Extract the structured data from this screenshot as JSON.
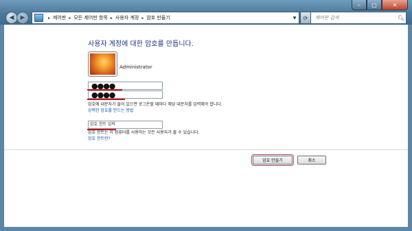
{
  "window": {
    "controls": {
      "minimize": "–",
      "maximize": "□",
      "close": "✕"
    }
  },
  "nav": {
    "back": "◀",
    "forward": "▶",
    "dropdown": "▼",
    "refresh": "⟳"
  },
  "breadcrumb": {
    "items": [
      "제어판",
      "모든 제어판 항목",
      "사용자 계정",
      "암호 만들기"
    ],
    "separator": "▸"
  },
  "search": {
    "placeholder": "제어판 검색",
    "icon": "search-icon"
  },
  "main": {
    "title": "사용자 계정에 대한 암호를 만듭니다.",
    "username": "Administrator",
    "new_password": "●●●●",
    "confirm_password": "●●●●",
    "case_note": "암호에 대문자가 들어 있으면 로그온할 때마다 해당 대문자를 입력해야 합니다.",
    "strong_password_link": "강력한 암호를 만드는 방법",
    "hint_placeholder": "암호 힌트 입력",
    "hint_note": "암호 힌트는 이 컴퓨터를 사용하는 모든 사용자가 볼 수 있습니다.",
    "hint_link": "암호 힌트란?"
  },
  "buttons": {
    "create": "암호 만들기",
    "cancel": "취소"
  },
  "colors": {
    "title": "#1e3287",
    "link": "#0a4fb5",
    "highlight": "#c4161c",
    "frame": "#4d7a9b"
  }
}
